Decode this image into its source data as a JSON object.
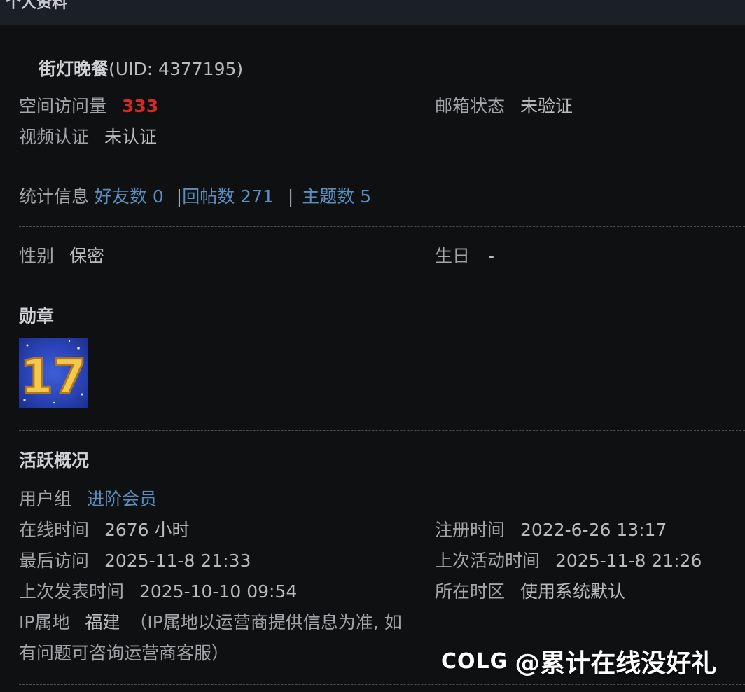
{
  "header": {
    "title": "个人资料"
  },
  "profile": {
    "username": "街灯晚餐",
    "uid": "(UID: 4377195)"
  },
  "info": {
    "space_visits_label": "空间访问量",
    "space_visits_value": "333",
    "email_label": "邮箱状态",
    "email_value": "未验证",
    "video_label": "视频认证",
    "video_value": "未认证"
  },
  "stats": {
    "label": "统计信息",
    "friends": "好友数 0",
    "replies": "回帖数 271",
    "threads": "主题数 5",
    "divider": "|"
  },
  "personal": {
    "gender_label": "性别",
    "gender_value": "保密",
    "birthday_label": "生日",
    "birthday_value": "-"
  },
  "medals": {
    "heading": "勋章",
    "badge_text": "17"
  },
  "activity": {
    "heading": "活跃概况",
    "group_label": "用户组",
    "group_value": "进阶会员",
    "online_label": "在线时间",
    "online_value": "2676 小时",
    "register_label": "注册时间",
    "register_value": "2022-6-26 13:17",
    "last_visit_label": "最后访问",
    "last_visit_value": "2025-11-8 21:33",
    "last_active_label": "上次活动时间",
    "last_active_value": "2025-11-8 21:26",
    "last_post_label": "上次发表时间",
    "last_post_value": "2025-10-10 09:54",
    "timezone_label": "所在时区",
    "timezone_value": "使用系统默认",
    "ip_label": "IP属地",
    "ip_value": "福建",
    "ip_note_line1": "（IP属地以运营商提供信息为准, 如",
    "ip_note_line2": "有问题可咨询运营商客服）"
  },
  "watermark": {
    "logo": "COLG",
    "text": "@累计在线没好礼"
  },
  "colors": {
    "link": "#5b8fc0",
    "highlight": "#d42a22",
    "background": "#0f1012"
  }
}
